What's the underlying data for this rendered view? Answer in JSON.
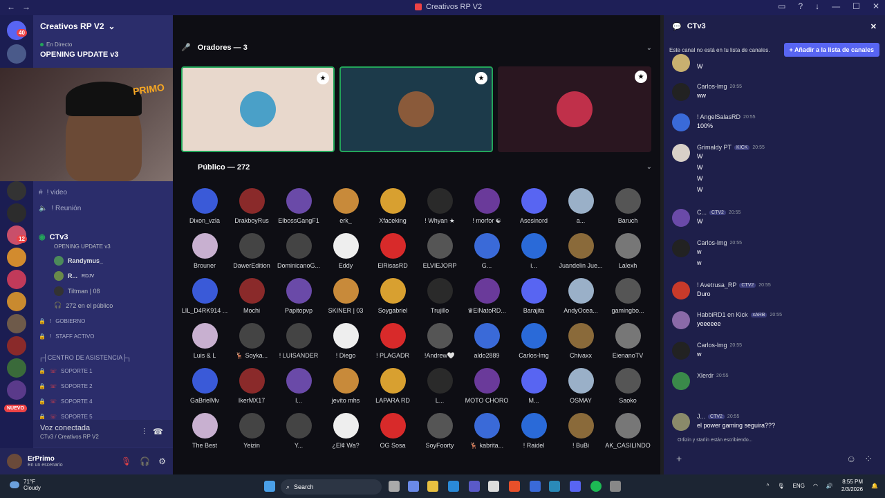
{
  "window": {
    "title": "Creativos RP V2"
  },
  "server": {
    "name": "Creativos RP V2",
    "live_label": "En Directo",
    "event_name": "OPENING UPDATE v3"
  },
  "sidebar": {
    "channels": [
      {
        "icon": "hash",
        "label": "! video"
      },
      {
        "icon": "speaker",
        "label": "! Reunión"
      }
    ],
    "stage": {
      "name": "CTv3",
      "topic": "OPENING UPDATE v3",
      "audience": "272 en el público"
    },
    "stage_users": [
      {
        "name": "Randymus_"
      },
      {
        "name": "R...",
        "tag": "RDJV"
      },
      {
        "name": "Tiltman | 08",
        "tag": "ACNL"
      }
    ],
    "locked": [
      {
        "label": "GOBIERNO"
      },
      {
        "label": "STAFF ACTIVO"
      }
    ],
    "category": "┌┤CENTRO DE ASISTENCIA├┐",
    "support": [
      {
        "label": "SOPORTE 1"
      },
      {
        "label": "SOPORTE 2"
      },
      {
        "label": "SOPORTE 4"
      },
      {
        "label": "SOPORTE 5"
      }
    ],
    "new_badge": "NUEVO"
  },
  "voice": {
    "status": "Voz conectada",
    "location": "CTv3 / Creativos RP V2"
  },
  "user": {
    "name": "ErPrimo",
    "status": "En un escenario"
  },
  "stage_view": {
    "speakers_title": "Oradores — 3",
    "audience_title": "Público — 272",
    "audience": [
      "Dixon_vzla",
      "DrakboyRus",
      "ElbossGangF1",
      "erk_",
      "Xfaceking",
      "! Whyan ★",
      "! morfor ☯",
      "Asesinord",
      "a...",
      "Baruch",
      "Brouner",
      "DawerEdition",
      "DominicanoG...",
      "Eddy",
      "ElRisasRD",
      "ELVIEJORP",
      "G...",
      "i...",
      "Juandelin Jue...",
      "Lalexh",
      "LIL_D4RK914 ...",
      "Mochi",
      "Papitopvp",
      "SKINER | 03",
      "Soygabriel",
      "Trujillo",
      "♛ElNatoRD...",
      "Barajita",
      "AndyOcea...",
      "gamingbo...",
      "Luis & L",
      "🦌 Soyka...",
      "! LUISANDER",
      "! Diego",
      "! PLAGADR",
      "!Andrew🤍",
      "aldo2889",
      "Carlos-lmg",
      "Chivaxx",
      "EienanoTV",
      "GaBrielMv",
      "IkerMX17",
      "l...",
      "jevito mhs",
      "LAPARA RD",
      "L...",
      "MOTO CHORO",
      "M...",
      "OSMAY",
      "Saoko",
      "The Best",
      "Yeizin",
      "Y...",
      "¿El¢ Wa?",
      "OG Sosa",
      "SoyFoorty",
      "🦌 kabrita...",
      "! Raidel",
      "! BuBi",
      "AK_CASILINDO"
    ]
  },
  "chat": {
    "channel": "CTv3",
    "notice": "Este canal no está en tu lista de canales.",
    "add_button": "Añadir a la lista de canales",
    "messages": [
      {
        "author": "",
        "time": "",
        "lines": [
          "W"
        ]
      },
      {
        "author": "Carlos-lmg",
        "time": "20:55",
        "lines": [
          "ww"
        ]
      },
      {
        "author": "! AngelSalasRD",
        "time": "20:55",
        "lines": [
          "100%"
        ]
      },
      {
        "author": "Grimaldy PT",
        "tag": "KICK",
        "time": "20:55",
        "lines": [
          "W",
          "W",
          "W",
          "W"
        ]
      },
      {
        "author": "C...",
        "tag": "CTV2",
        "time": "20:55",
        "lines": [
          "W"
        ]
      },
      {
        "author": "Carlos-lmg",
        "time": "20:55",
        "lines": [
          "w",
          "w"
        ]
      },
      {
        "author": "! Avetrusa_RP",
        "tag": "CTV2",
        "time": "20:55",
        "lines": [
          "Duro"
        ]
      },
      {
        "author": "HabbiRD1 en Kick",
        "tag": "xARB",
        "time": "20:55",
        "lines": [
          "yeeeeee"
        ]
      },
      {
        "author": "Carlos-lmg",
        "time": "20:55",
        "lines": [
          "w"
        ]
      },
      {
        "author": "Xlerdr",
        "time": "20:55",
        "lines": [
          ""
        ]
      },
      {
        "author": "J...",
        "tag": "CTV2",
        "time": "20:55",
        "lines": [
          "el power gaming seguira???"
        ]
      }
    ],
    "typing": "Orlizin y starlin están escribiendo..."
  },
  "taskbar": {
    "weather_temp": "71°F",
    "weather_desc": "Cloudy",
    "search": "Search",
    "lang": "ENG",
    "time": "8:55 PM",
    "date": "2/3/2026"
  },
  "colors": {
    "accent": "#5865f2",
    "live": "#23a55a",
    "alert": "#ed4245"
  }
}
